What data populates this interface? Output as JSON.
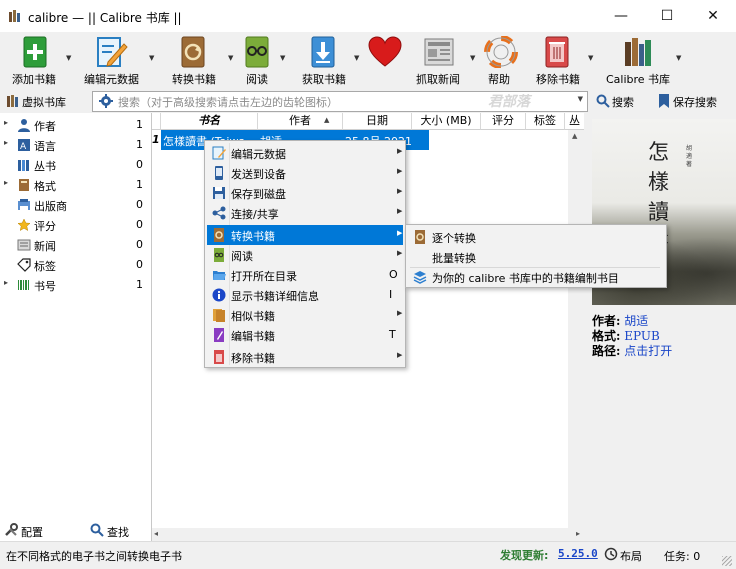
{
  "window": {
    "title": "calibre — || Calibre 书库 ||",
    "minimize": "—",
    "maximize": "☐",
    "close": "✕"
  },
  "toolbar": {
    "add_book": "添加书籍",
    "edit_metadata": "编辑元数据",
    "convert": "转换书籍",
    "read": "阅读",
    "get_books": "获取书籍",
    "fetch_news": "抓取新闻",
    "help": "帮助",
    "remove_book": "移除书籍",
    "library": "Calibre 书库"
  },
  "searchbar": {
    "virtual_library": "虚拟书库",
    "placeholder": "搜索（对于高级搜索请点击左边的齿轮图标）",
    "search_button": "搜索",
    "save_search": "保存搜索",
    "watermark": "君部落"
  },
  "tag_browser": {
    "items": [
      {
        "label": "作者",
        "count": "1",
        "expander": "▸"
      },
      {
        "label": "语言",
        "count": "1",
        "expander": "▸"
      },
      {
        "label": "丛书",
        "count": "0",
        "expander": ""
      },
      {
        "label": "格式",
        "count": "1",
        "expander": "▸"
      },
      {
        "label": "出版商",
        "count": "0",
        "expander": ""
      },
      {
        "label": "评分",
        "count": "0",
        "expander": ""
      },
      {
        "label": "新闻",
        "count": "0",
        "expander": ""
      },
      {
        "label": "标签",
        "count": "0",
        "expander": ""
      },
      {
        "label": "书号",
        "count": "1",
        "expander": "▸"
      }
    ],
    "configure": "配置",
    "find": "查找"
  },
  "book_list": {
    "columns": [
      "书名",
      "作者",
      "日期",
      "大小 (MB)",
      "评分",
      "标签",
      "丛"
    ],
    "rows": [
      {
        "num": "1",
        "title": "怎樣讀書 (Taiwa…",
        "author": "胡适",
        "date": "25 8月 2021",
        "size": "0.9"
      }
    ]
  },
  "context_menu": {
    "items": [
      {
        "label": "编辑元数据",
        "shortcut": "",
        "submenu": true
      },
      {
        "label": "发送到设备",
        "shortcut": "",
        "submenu": true
      },
      {
        "label": "保存到磁盘",
        "shortcut": "",
        "submenu": true
      },
      {
        "label": "连接/共享",
        "shortcut": "",
        "submenu": true
      },
      {
        "label": "转换书籍",
        "shortcut": "",
        "submenu": true
      },
      {
        "label": "阅读",
        "shortcut": "",
        "submenu": true
      },
      {
        "label": "打开所在目录",
        "shortcut": "O",
        "submenu": false
      },
      {
        "label": "显示书籍详细信息",
        "shortcut": "I",
        "submenu": false
      },
      {
        "label": "相似书籍",
        "shortcut": "",
        "submenu": true
      },
      {
        "label": "编辑书籍",
        "shortcut": "T",
        "submenu": false
      },
      {
        "label": "移除书籍",
        "shortcut": "",
        "submenu": true
      }
    ],
    "submenu_arrow": "▶"
  },
  "convert_submenu": {
    "items": [
      "逐个转换",
      "批量转换",
      "为你的 calibre 书库中的书籍编制书目"
    ]
  },
  "book_details": {
    "cover_title": "怎樣讀書",
    "cover_author": "胡適著",
    "author_label": "作者:",
    "author_value": "胡适",
    "format_label": "格式:",
    "format_value": "EPUB",
    "path_label": "路径:",
    "path_value": "点击打开"
  },
  "status": {
    "message": "在不同格式的电子书之间转换电子书",
    "update_label": "发现更新:",
    "update_version": "5.25.0",
    "layout": "布局",
    "jobs": "任务:  0"
  },
  "colors": {
    "accent": "#0078d7",
    "update_green": "#2e7d32",
    "link_blue": "#1a46c8"
  }
}
